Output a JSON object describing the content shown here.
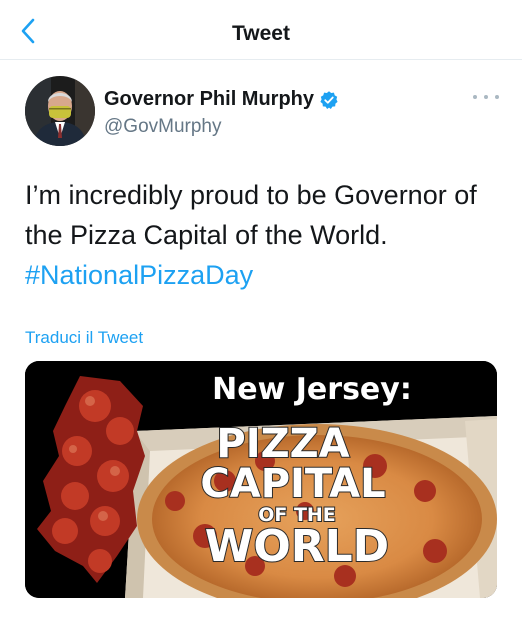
{
  "nav": {
    "title": "Tweet"
  },
  "author": {
    "name": "Governor Phil Murphy",
    "handle": "@GovMurphy"
  },
  "tweet": {
    "text_line1": "I’m incredibly proud to be Governor of",
    "text_line2": "the Pizza Capital of the World.",
    "hashtag": "#NationalPizzaDay",
    "translate_label": "Traduci il Tweet"
  },
  "media": {
    "heading": "New Jersey:",
    "line1": "PIZZA",
    "line2": "CAPITAL",
    "line3": "OF THE",
    "line4": "WORLD"
  },
  "icons": {
    "back": "chevron-left-icon",
    "verified": "verified-badge-icon",
    "more": "more-horizontal-icon"
  },
  "colors": {
    "accent": "#1da1f2",
    "text": "#14171a",
    "secondary": "#657786"
  }
}
